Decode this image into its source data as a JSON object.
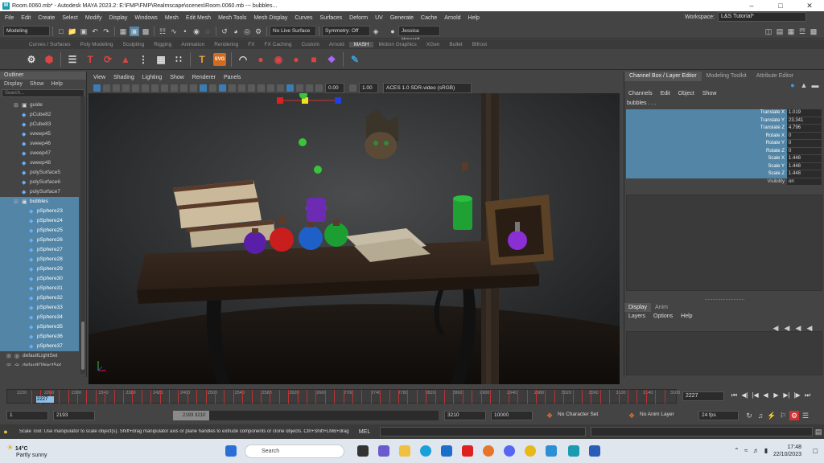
{
  "window": {
    "title": "Room.0060.mb* - Autodesk MAYA 2023.2: E:\\FMP\\FMP\\Realmscape\\scenes\\Room.0060.mb  ---  bubbles..."
  },
  "menubar": [
    "File",
    "Edit",
    "Create",
    "Select",
    "Modify",
    "Display",
    "Windows",
    "Mesh",
    "Edit Mesh",
    "Mesh Tools",
    "Mesh Display",
    "Curves",
    "Surfaces",
    "Deform",
    "UV",
    "Generate",
    "Cache",
    "Arnold",
    "Help"
  ],
  "workspace": {
    "label": "Workspace:",
    "value": "L&S Tutorial*"
  },
  "statusline": {
    "mode": "Modeling",
    "live": "No Live Surface",
    "symmetry": "Symmetry: Off",
    "user": "Jessica Howard"
  },
  "shelf_tabs": [
    "Curves / Surfaces",
    "Poly Modeling",
    "Sculpting",
    "Rigging",
    "Animation",
    "Rendering",
    "FX",
    "FX Caching",
    "Custom",
    "Arnold",
    "MASH",
    "Motion Graphics",
    "XGen",
    "Bullet",
    "Bifrost"
  ],
  "shelf_active": "MASH",
  "outliner": {
    "title": "Outliner",
    "menus": [
      "Display",
      "Show",
      "Help"
    ],
    "search_placeholder": "Search...",
    "items": [
      {
        "label": "guide",
        "selected": false,
        "indent": 1,
        "icon": "group"
      },
      {
        "label": "pCube82",
        "selected": false,
        "indent": 1,
        "icon": "mesh"
      },
      {
        "label": "pCube83",
        "selected": false,
        "indent": 1,
        "icon": "mesh"
      },
      {
        "label": "sweep45",
        "selected": false,
        "indent": 1,
        "icon": "mesh"
      },
      {
        "label": "sweep46",
        "selected": false,
        "indent": 1,
        "icon": "mesh"
      },
      {
        "label": "sweep47",
        "selected": false,
        "indent": 1,
        "icon": "mesh"
      },
      {
        "label": "sweep48",
        "selected": false,
        "indent": 1,
        "icon": "mesh"
      },
      {
        "label": "polySurface5",
        "selected": false,
        "indent": 1,
        "icon": "mesh"
      },
      {
        "label": "polySurface6",
        "selected": false,
        "indent": 1,
        "icon": "mesh"
      },
      {
        "label": "polySurface7",
        "selected": false,
        "indent": 1,
        "icon": "mesh"
      },
      {
        "label": "bubbles",
        "selected": true,
        "indent": 1,
        "icon": "group"
      },
      {
        "label": "pSphere23",
        "selected": true,
        "indent": 2,
        "icon": "mesh"
      },
      {
        "label": "pSphere24",
        "selected": true,
        "indent": 2,
        "icon": "mesh"
      },
      {
        "label": "pSphere25",
        "selected": true,
        "indent": 2,
        "icon": "mesh"
      },
      {
        "label": "pSphere26",
        "selected": true,
        "indent": 2,
        "icon": "mesh"
      },
      {
        "label": "pSphere27",
        "selected": true,
        "indent": 2,
        "icon": "mesh"
      },
      {
        "label": "pSphere28",
        "selected": true,
        "indent": 2,
        "icon": "mesh"
      },
      {
        "label": "pSphere29",
        "selected": true,
        "indent": 2,
        "icon": "mesh"
      },
      {
        "label": "pSphere30",
        "selected": true,
        "indent": 2,
        "icon": "mesh"
      },
      {
        "label": "pSphere31",
        "selected": true,
        "indent": 2,
        "icon": "mesh"
      },
      {
        "label": "pSphere32",
        "selected": true,
        "indent": 2,
        "icon": "mesh"
      },
      {
        "label": "pSphere33",
        "selected": true,
        "indent": 2,
        "icon": "mesh"
      },
      {
        "label": "pSphere34",
        "selected": true,
        "indent": 2,
        "icon": "mesh"
      },
      {
        "label": "pSphere35",
        "selected": true,
        "indent": 2,
        "icon": "mesh"
      },
      {
        "label": "pSphere36",
        "selected": true,
        "indent": 2,
        "icon": "mesh"
      },
      {
        "label": "pSphere37",
        "selected": true,
        "indent": 2,
        "icon": "mesh"
      },
      {
        "label": "defaultLightSet",
        "selected": false,
        "indent": 0,
        "icon": "set"
      },
      {
        "label": "defaultObjectSet",
        "selected": false,
        "indent": 0,
        "icon": "set"
      }
    ]
  },
  "viewport": {
    "menus": [
      "View",
      "Shading",
      "Lighting",
      "Show",
      "Renderer",
      "Panels"
    ],
    "exposure": "0.00",
    "gamma": "1.00",
    "colorspace": "ACES 1.0 SDR-video (sRGB)"
  },
  "channelbox": {
    "tabs": [
      "Channel Box / Layer Editor",
      "Modeling Toolkit",
      "Attribute Editor"
    ],
    "menus": [
      "Channels",
      "Edit",
      "Object",
      "Show"
    ],
    "object": "bubbles . . .",
    "attrs": [
      {
        "label": "Translate X",
        "value": "1.019",
        "keyed": true
      },
      {
        "label": "Translate Y",
        "value": "23.341",
        "keyed": true
      },
      {
        "label": "Translate Z",
        "value": "4.796",
        "keyed": true
      },
      {
        "label": "Rotate X",
        "value": "0",
        "keyed": true
      },
      {
        "label": "Rotate Y",
        "value": "0",
        "keyed": true
      },
      {
        "label": "Rotate Z",
        "value": "0",
        "keyed": true
      },
      {
        "label": "Scale X",
        "value": "1.448",
        "keyed": true
      },
      {
        "label": "Scale Y",
        "value": "1.448",
        "keyed": true
      },
      {
        "label": "Scale Z",
        "value": "1.448",
        "keyed": true
      },
      {
        "label": "Visibility",
        "value": "on",
        "keyed": false
      }
    ],
    "layer_tabs": [
      "Display",
      "Anim"
    ],
    "layer_menus": [
      "Layers",
      "Options",
      "Help"
    ]
  },
  "timeslider": {
    "ticks": [
      "2220",
      "2260",
      "2300",
      "2340",
      "2380",
      "2420",
      "2460",
      "2500",
      "2540",
      "2580",
      "2620",
      "2660",
      "2700",
      "2740",
      "2780",
      "2820",
      "2860",
      "2900",
      "2940",
      "2980",
      "3020",
      "3060",
      "3100",
      "3140",
      "3180"
    ],
    "current": "2227",
    "frame_field": "2227"
  },
  "rangeslider": {
    "start": "1",
    "playback_start": "2193",
    "range_label": "2193  3210",
    "playback_end": "3210",
    "end": "10000",
    "character_set": "No Character Set",
    "anim_layer": "No Anim Layer",
    "fps": "24 fps"
  },
  "helpline": {
    "text": "Scale Tool: Use manipulator to scale object(s). Shift+drag manipulator axis or plane handles to extrude components or clone objects. Ctrl+Shift+LMB+drag",
    "mel": "MEL"
  },
  "taskbar": {
    "temp": "14°C",
    "weather": "Partly sunny",
    "search": "Search",
    "time": "17:48",
    "date": "22/10/2023",
    "lang": "ENG"
  }
}
